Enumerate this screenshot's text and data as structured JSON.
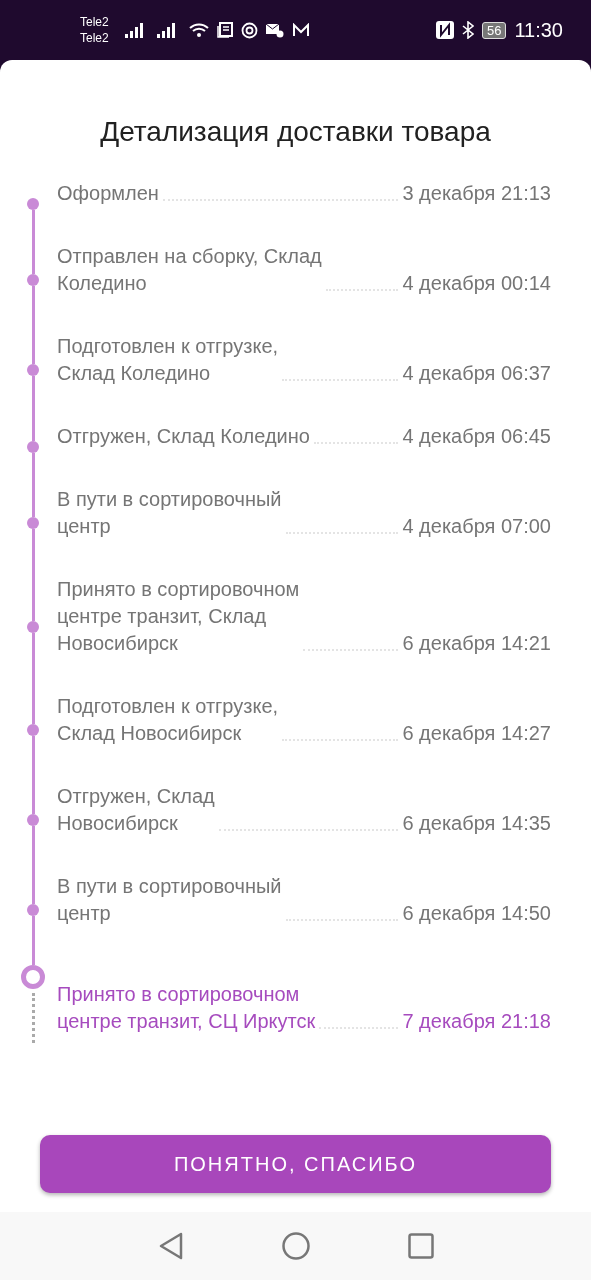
{
  "status_bar": {
    "carriers": [
      "Tele2",
      "Tele2"
    ],
    "battery": "56",
    "time": "11:30"
  },
  "title": "Детализация доставки товара",
  "events": [
    {
      "lines": [
        "Оформлен"
      ],
      "date": "3 декабря 21:13",
      "current": false
    },
    {
      "lines": [
        "Отправлен на сборку, Склад",
        "Коледино"
      ],
      "date": "4 декабря 00:14",
      "current": false
    },
    {
      "lines": [
        "Подготовлен к отгрузке,",
        "Склад Коледино"
      ],
      "date": "4 декабря 06:37",
      "current": false
    },
    {
      "lines": [
        "Отгружен, Склад Коледино"
      ],
      "date": "4 декабря 06:45",
      "current": false
    },
    {
      "lines": [
        "В пути в сортировочный",
        "центр"
      ],
      "date": "4 декабря 07:00",
      "current": false
    },
    {
      "lines": [
        "Принято в сортировочном",
        "центре транзит, Склад",
        "Новосибирск"
      ],
      "date": "6 декабря 14:21",
      "current": false
    },
    {
      "lines": [
        "Подготовлен к отгрузке,",
        "Склад Новосибирск"
      ],
      "date": "6 декабря 14:27",
      "current": false
    },
    {
      "lines": [
        "Отгружен, Склад",
        "Новосибирск"
      ],
      "date": "6 декабря 14:35",
      "current": false
    },
    {
      "lines": [
        "В пути в сортировочный",
        "центр"
      ],
      "date": "6 декабря 14:50",
      "current": false
    },
    {
      "lines": [
        "Принято в сортировочном",
        "центре транзит, СЦ Иркутск"
      ],
      "date": "7 декабря 21:18",
      "current": true
    }
  ],
  "button": "ПОНЯТНО, СПАСИБО"
}
